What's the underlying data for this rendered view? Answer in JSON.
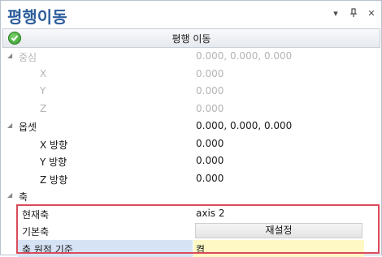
{
  "window": {
    "title": "평행이동",
    "buttons": [
      "▾",
      "ᵩ",
      "×"
    ]
  },
  "toolbar": {
    "label": "평행 이동"
  },
  "rows": {
    "center": {
      "name": "중심",
      "value": "0.000, 0.000, 0.000"
    },
    "center_x": {
      "name": "X",
      "value": "0.000"
    },
    "center_y": {
      "name": "Y",
      "value": "0.000"
    },
    "center_z": {
      "name": "Z",
      "value": "0.000"
    },
    "offset": {
      "name": "옵셋",
      "value": "0.000, 0.000, 0.000"
    },
    "offset_x": {
      "name": "X 방향",
      "value": "0.000"
    },
    "offset_y": {
      "name": "Y 방향",
      "value": "0.000"
    },
    "offset_z": {
      "name": "Z 방향",
      "value": "0.000"
    },
    "axis": {
      "name": "축"
    },
    "current_axis": {
      "name": "현재축",
      "value": "axis 2"
    },
    "base_axis": {
      "name": "기본축",
      "button": "재설정"
    },
    "axis_origin": {
      "name": "축 원점 기준",
      "value": "켬"
    }
  }
}
